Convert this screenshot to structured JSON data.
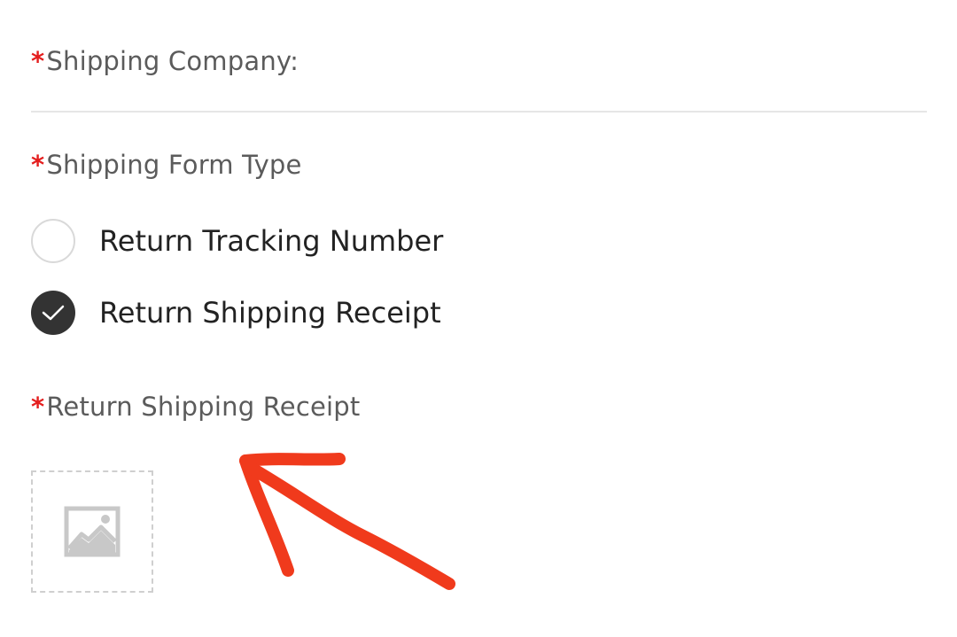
{
  "form": {
    "shipping_company": {
      "required_mark": "*",
      "label": "Shipping Company:",
      "value": ""
    },
    "shipping_form_type": {
      "required_mark": "*",
      "label": "Shipping Form Type",
      "options": [
        {
          "label": "Return Tracking Number",
          "selected": false
        },
        {
          "label": "Return Shipping Receipt",
          "selected": true
        }
      ]
    },
    "return_shipping_receipt": {
      "required_mark": "*",
      "label": "Return Shipping Receipt",
      "upload_icon": "image-placeholder-icon"
    }
  },
  "annotation": {
    "type": "hand-drawn-arrow",
    "color": "#f03a1c"
  },
  "colors": {
    "required": "#e41e1e",
    "label": "#5b5b5b",
    "radio_checked": "#333333",
    "divider": "#e6e6e6"
  }
}
